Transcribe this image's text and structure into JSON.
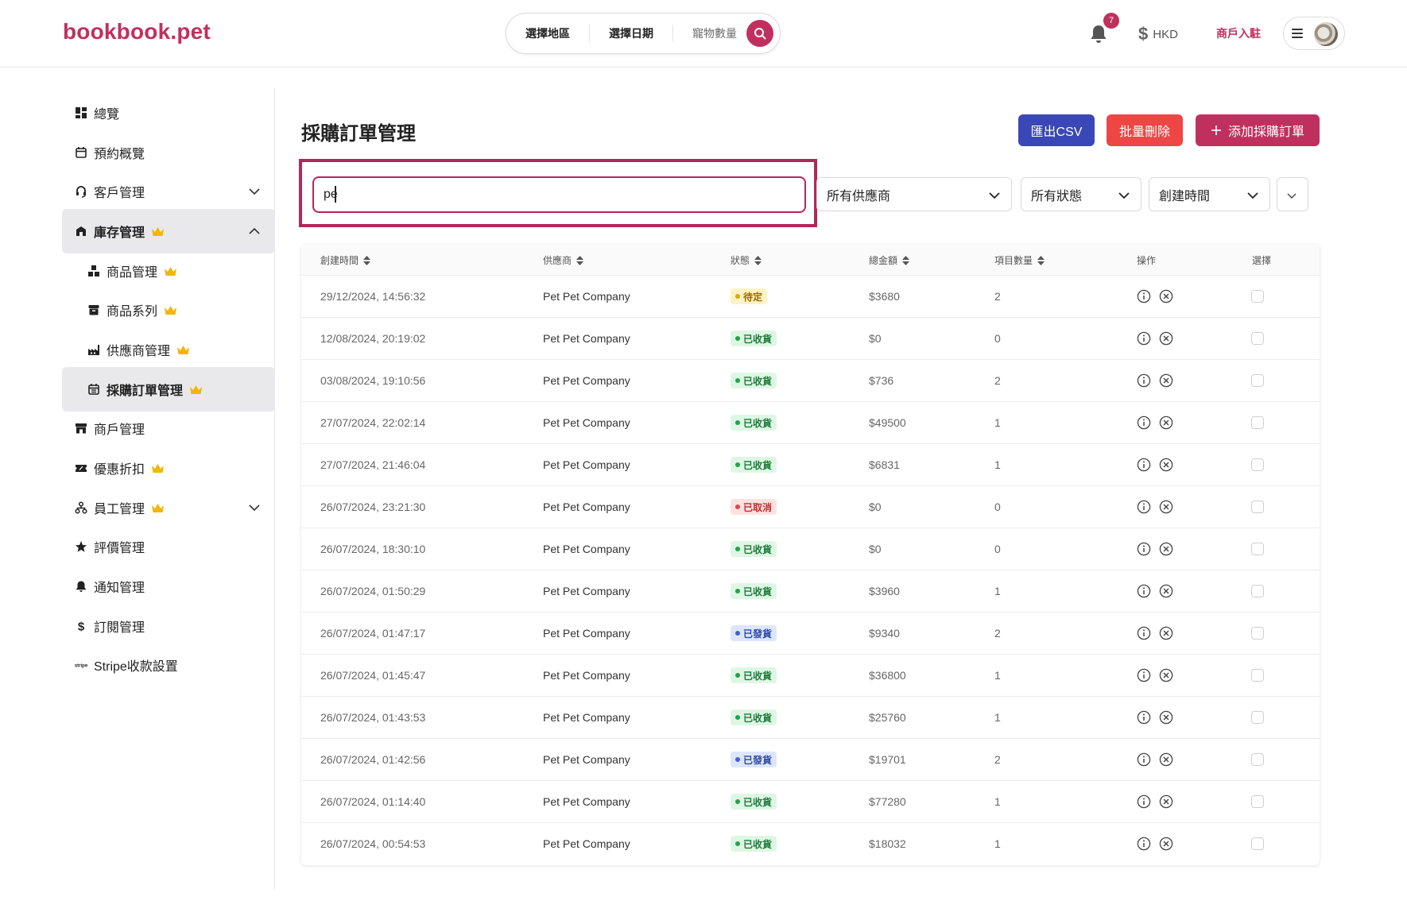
{
  "header": {
    "logo": "bookbook.pet",
    "search": {
      "region": "選擇地區",
      "date": "選擇日期",
      "pets": "寵物數量"
    },
    "notification_count": "7",
    "currency": "HKD",
    "merchant_link": "商戶入駐"
  },
  "sidebar": {
    "items": [
      {
        "label": "總覽",
        "icon": "dashboard-icon"
      },
      {
        "label": "預約概覽",
        "icon": "calendar-icon"
      },
      {
        "label": "客戶管理",
        "icon": "headset-icon",
        "expandable": true
      },
      {
        "label": "庫存管理",
        "icon": "store-icon",
        "expanded": true,
        "premium": true
      },
      {
        "label": "商品管理",
        "icon": "boxes-icon",
        "premium": true,
        "sub": true
      },
      {
        "label": "商品系列",
        "icon": "archive-icon",
        "premium": true,
        "sub": true
      },
      {
        "label": "供應商管理",
        "icon": "factory-icon",
        "premium": true,
        "sub": true
      },
      {
        "label": "採購訂單管理",
        "icon": "calendar-list-icon",
        "premium": true,
        "sub": true,
        "active": true
      },
      {
        "label": "商戶管理",
        "icon": "shop-icon"
      },
      {
        "label": "優惠折扣",
        "icon": "ticket-icon",
        "premium": true
      },
      {
        "label": "員工管理",
        "icon": "org-chart-icon",
        "premium": true,
        "expandable": true
      },
      {
        "label": "評價管理",
        "icon": "star-icon"
      },
      {
        "label": "通知管理",
        "icon": "bell-icon"
      },
      {
        "label": "訂閱管理",
        "icon": "dollar-icon"
      },
      {
        "label": "Stripe收款設置",
        "icon": "stripe-icon"
      }
    ]
  },
  "page": {
    "title": "採購訂單管理",
    "buttons": {
      "export": "匯出CSV",
      "bulk_delete": "批量刪除",
      "add": "添加採購訂單"
    },
    "search_value": "pe",
    "filters": {
      "supplier": "所有供應商",
      "status": "所有狀態",
      "sort": "創建時間"
    }
  },
  "table": {
    "columns": [
      "創建時間",
      "供應商",
      "狀態",
      "總金額",
      "項目數量",
      "操作",
      "選擇"
    ],
    "rows": [
      {
        "created": "29/12/2024, 14:56:32",
        "supplier": "Pet Pet Company",
        "status": "待定",
        "status_type": "pending",
        "total": "$3680",
        "items": "2"
      },
      {
        "created": "12/08/2024, 20:19:02",
        "supplier": "Pet Pet Company",
        "status": "已收貨",
        "status_type": "received",
        "total": "$0",
        "items": "0"
      },
      {
        "created": "03/08/2024, 19:10:56",
        "supplier": "Pet Pet Company",
        "status": "已收貨",
        "status_type": "received",
        "total": "$736",
        "items": "2"
      },
      {
        "created": "27/07/2024, 22:02:14",
        "supplier": "Pet Pet Company",
        "status": "已收貨",
        "status_type": "received",
        "total": "$49500",
        "items": "1"
      },
      {
        "created": "27/07/2024, 21:46:04",
        "supplier": "Pet Pet Company",
        "status": "已收貨",
        "status_type": "received",
        "total": "$6831",
        "items": "1"
      },
      {
        "created": "26/07/2024, 23:21:30",
        "supplier": "Pet Pet Company",
        "status": "已取消",
        "status_type": "cancelled",
        "total": "$0",
        "items": "0"
      },
      {
        "created": "26/07/2024, 18:30:10",
        "supplier": "Pet Pet Company",
        "status": "已收貨",
        "status_type": "received",
        "total": "$0",
        "items": "0"
      },
      {
        "created": "26/07/2024, 01:50:29",
        "supplier": "Pet Pet Company",
        "status": "已收貨",
        "status_type": "received",
        "total": "$3960",
        "items": "1"
      },
      {
        "created": "26/07/2024, 01:47:17",
        "supplier": "Pet Pet Company",
        "status": "已發貨",
        "status_type": "shipped",
        "total": "$9340",
        "items": "2"
      },
      {
        "created": "26/07/2024, 01:45:47",
        "supplier": "Pet Pet Company",
        "status": "已收貨",
        "status_type": "received",
        "total": "$36800",
        "items": "1"
      },
      {
        "created": "26/07/2024, 01:43:53",
        "supplier": "Pet Pet Company",
        "status": "已收貨",
        "status_type": "received",
        "total": "$25760",
        "items": "1"
      },
      {
        "created": "26/07/2024, 01:42:56",
        "supplier": "Pet Pet Company",
        "status": "已發貨",
        "status_type": "shipped",
        "total": "$19701",
        "items": "2"
      },
      {
        "created": "26/07/2024, 01:14:40",
        "supplier": "Pet Pet Company",
        "status": "已收貨",
        "status_type": "received",
        "total": "$77280",
        "items": "1"
      },
      {
        "created": "26/07/2024, 00:54:53",
        "supplier": "Pet Pet Company",
        "status": "已收貨",
        "status_type": "received",
        "total": "$18032",
        "items": "1"
      }
    ]
  },
  "colors": {
    "brand": "#c0305f",
    "export_button": "#3a47b6",
    "delete_button": "#ee4545",
    "premium_crown": "#f2b705",
    "status": {
      "pending": {
        "bg": "#fdf3c4",
        "fg": "#9a6b00",
        "dot": "#e0a800"
      },
      "received": {
        "bg": "#def7e4",
        "fg": "#1f7a3a",
        "dot": "#22a447"
      },
      "cancelled": {
        "bg": "#fde2e2",
        "fg": "#c0302f",
        "dot": "#e04848"
      },
      "shipped": {
        "bg": "#dde6fb",
        "fg": "#2f4aa6",
        "dot": "#3d63d6"
      }
    }
  }
}
